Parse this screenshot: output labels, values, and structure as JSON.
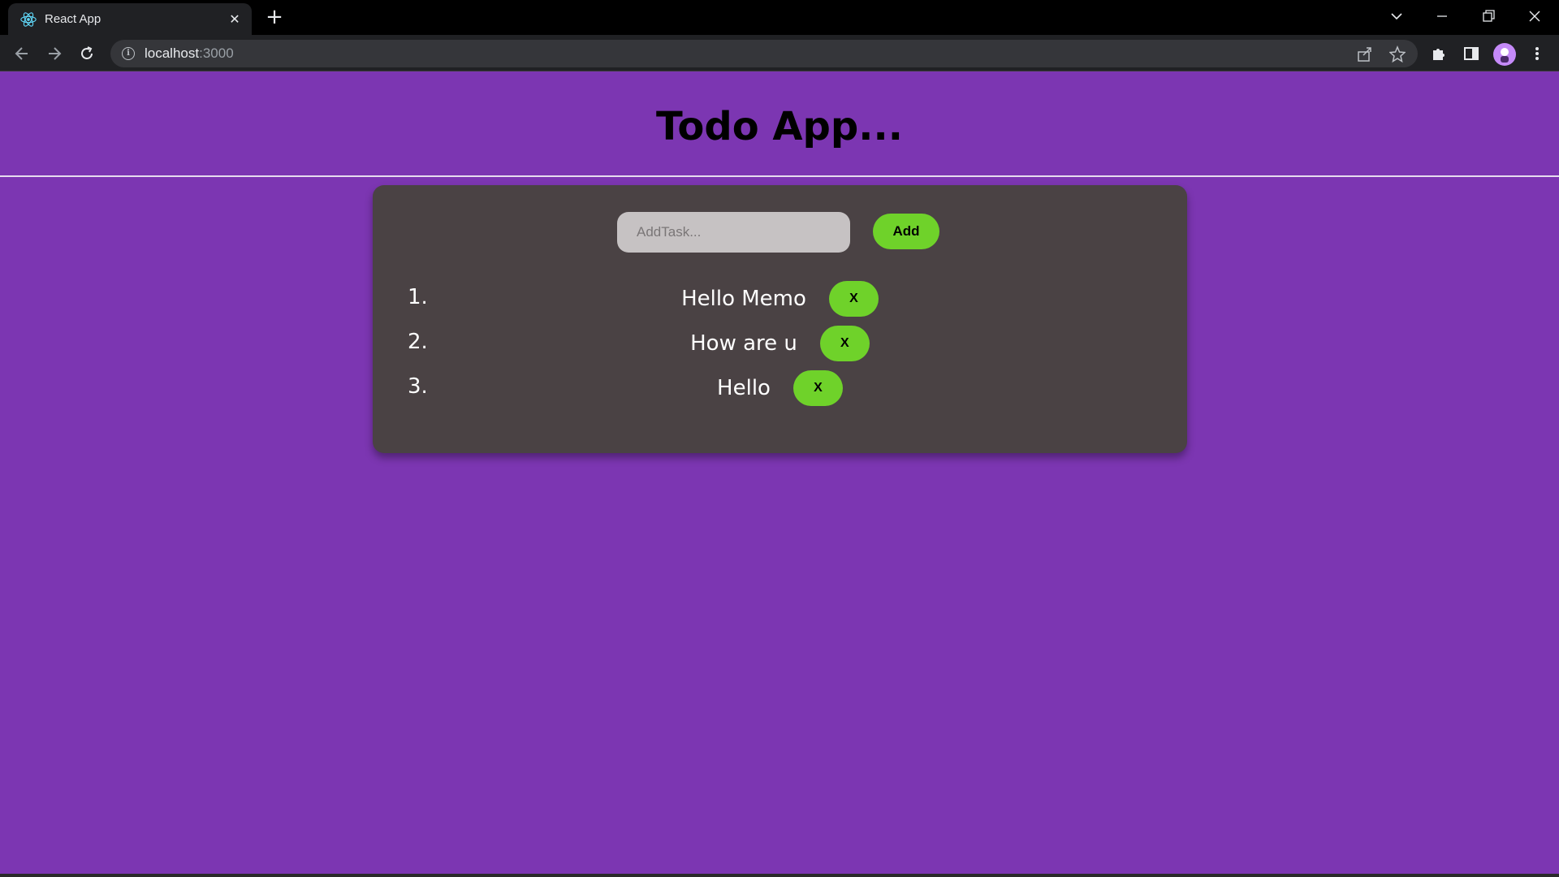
{
  "browser": {
    "tab_title": "React App",
    "tab_close": "✕",
    "new_tab": "+",
    "url_host": "localhost",
    "url_port": ":3000"
  },
  "app": {
    "title": "Todo App...",
    "input_placeholder": "AddTask...",
    "add_label": "Add",
    "todos": [
      {
        "number": "1.",
        "text": "Hello Memo",
        "delete_label": "X"
      },
      {
        "number": "2.",
        "text": "How are u",
        "delete_label": "X"
      },
      {
        "number": "3.",
        "text": "Hello",
        "delete_label": "X"
      }
    ]
  },
  "colors": {
    "page_background": "#7c36b2",
    "card_background": "#4a4244",
    "button_green": "#6fd22a",
    "input_background": "#c6c2c3"
  }
}
